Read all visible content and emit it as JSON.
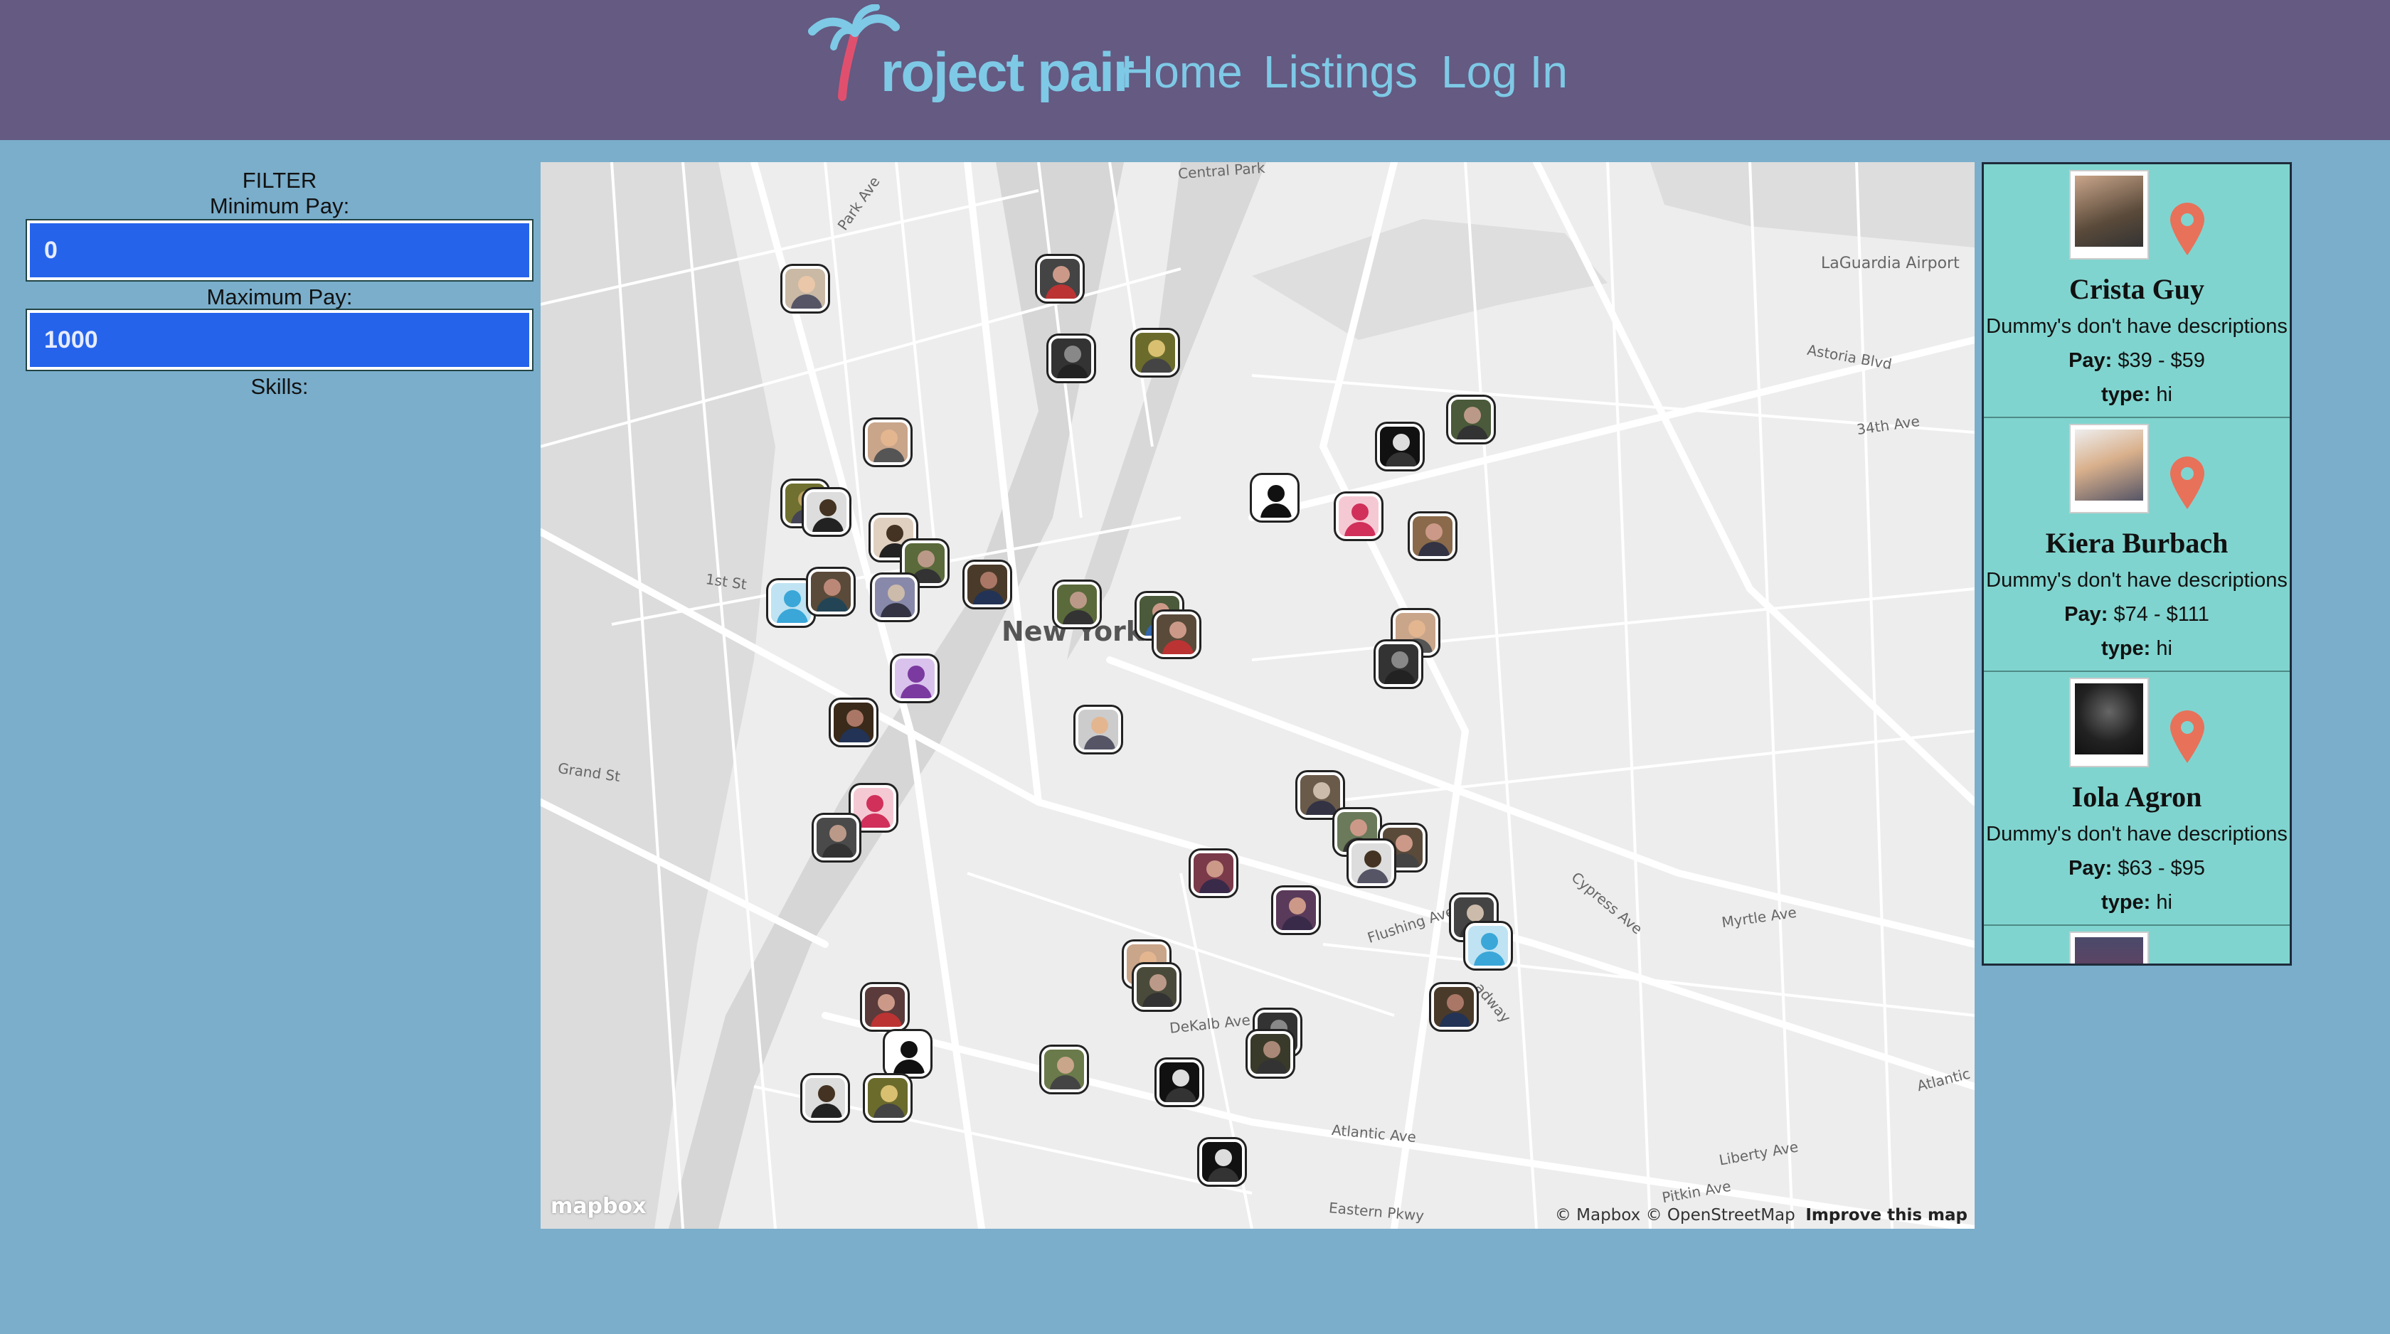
{
  "header": {
    "logo_text": "roject pair",
    "nav": {
      "home": "Home",
      "listings": "Listings",
      "login": "Log In"
    }
  },
  "filter": {
    "title": "FILTER",
    "min_label": "Minimum Pay:",
    "min_value": "0",
    "max_label": "Maximum Pay:",
    "max_value": "1000",
    "skills_label": "Skills:"
  },
  "map": {
    "city_label": "New York",
    "labels": {
      "laguardia": "LaGuardia Airport",
      "astoria": "Astoria Blvd",
      "ave34": "34th Ave",
      "myrtle": "Myrtle Ave",
      "flushing": "Flushing Ave",
      "dekalb": "DeKalb Ave",
      "atlantic": "Atlantic Ave",
      "atlantic2": "Atlantic A",
      "liberty": "Liberty Ave",
      "pitkin": "Pitkin Ave",
      "eastern": "Eastern Pkwy",
      "grand": "Grand St",
      "first_st": "1st St",
      "cypress": "Cypress Ave",
      "central_park": "Central Park",
      "park_ave": "Park Ave",
      "broadway": "adway"
    },
    "attribution": "© Mapbox © OpenStreetMap",
    "improve": "Improve this map",
    "mapbox": "mapbox"
  },
  "listings": [
    {
      "name": "Crista Guy",
      "description": "Dummy's don't have descriptions",
      "pay_label": "Pay:",
      "pay": "$39 - $59",
      "type_label": "type:",
      "type": "hi"
    },
    {
      "name": "Kiera Burbach",
      "description": "Dummy's don't have descriptions",
      "pay_label": "Pay:",
      "pay": "$74 - $111",
      "type_label": "type:",
      "type": "hi"
    },
    {
      "name": "Iola Agron",
      "description": "Dummy's don't have descriptions",
      "pay_label": "Pay:",
      "pay": "$63 - $95",
      "type_label": "type:",
      "type": "hi"
    }
  ],
  "colors": {
    "header_bg": "#645a82",
    "page_bg": "#7aaecb",
    "nav_text": "#7ec9e6",
    "input_bg": "#2563eb",
    "listing_bg": "#80d4cf",
    "marker": "#e8715a"
  }
}
